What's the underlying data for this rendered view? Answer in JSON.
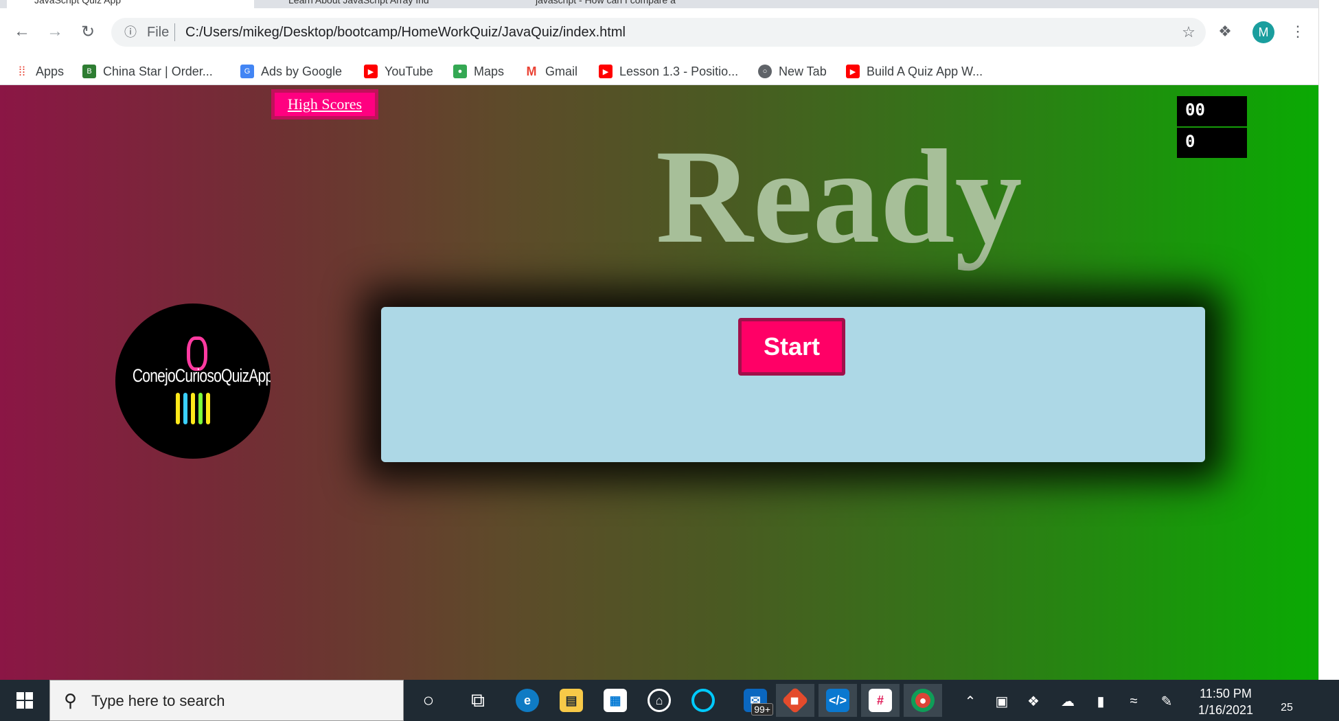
{
  "browser": {
    "tabs": [
      {
        "label": "JavaScript Quiz App"
      },
      {
        "label": "Learn About JavaScript Array Ind"
      },
      {
        "label": "javascript - How can I compare a"
      }
    ],
    "address": {
      "scheme": "File",
      "url": "C:/Users/mikeg/Desktop/bootcamp/HomeWorkQuiz/JavaQuiz/index.html"
    },
    "profile_initial": "M",
    "bookmarks": [
      {
        "label": "Apps",
        "icon": "apps-grid-icon",
        "color": "#ea4335"
      },
      {
        "label": "China Star | Order...",
        "icon": "china-star-icon",
        "color": "#2e7d32"
      },
      {
        "label": "Ads by Google",
        "icon": "google-ads-icon",
        "color": "#4285f4"
      },
      {
        "label": "YouTube",
        "icon": "youtube-icon",
        "color": "#ff0000"
      },
      {
        "label": "Maps",
        "icon": "maps-icon",
        "color": "#34a853"
      },
      {
        "label": "Gmail",
        "icon": "gmail-icon",
        "color": "#ea4335"
      },
      {
        "label": "Lesson 1.3 - Positio...",
        "icon": "youtube-icon",
        "color": "#ff0000"
      },
      {
        "label": "New Tab",
        "icon": "globe-icon",
        "color": "#5f6368"
      },
      {
        "label": "Build A Quiz App W...",
        "icon": "youtube-icon",
        "color": "#ff0000"
      }
    ]
  },
  "page": {
    "high_scores_label": "High Scores",
    "timer": "00",
    "score": "0",
    "heading": "Ready",
    "logo_text": "ConejoCuriosoQuizApp!",
    "start_label": "Start",
    "colors": {
      "gradient_left": "#8b1645",
      "gradient_right": "#0aaa03",
      "accent": "#ff0066",
      "quiz_box": "#add8e6"
    }
  },
  "taskbar": {
    "search_placeholder": "Type here to search",
    "mail_badge": "99+",
    "time": "11:50 PM",
    "date": "1/16/2021",
    "notification_count": "25"
  }
}
